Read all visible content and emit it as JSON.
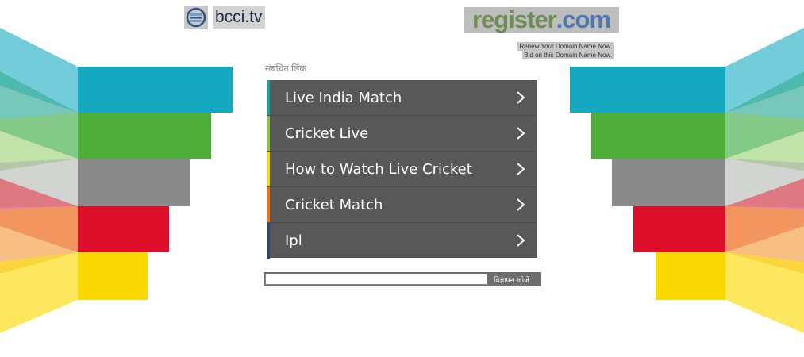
{
  "site": {
    "logo_text": "bcci.tv",
    "logo_icon": "e-logo-icon"
  },
  "registrar": {
    "logo_main": "register",
    "logo_tld": ".com",
    "links": [
      "Renew Your Domain Name Now.",
      "Bid on this Domain Name Now."
    ]
  },
  "related": {
    "title": "संबंधित लिंक",
    "items": [
      {
        "label": "Live India Match",
        "accent": "#1f9fa2"
      },
      {
        "label": "Cricket Live",
        "accent": "#8cc63f"
      },
      {
        "label": "How to Watch Live Cricket",
        "accent": "#f5d60a"
      },
      {
        "label": "Cricket Match",
        "accent": "#e8731c"
      },
      {
        "label": "Ipl",
        "accent": "#2a4a6e"
      }
    ],
    "chevron_icon": "chevron-right-icon"
  },
  "search": {
    "value": "",
    "button_label": "विज्ञापन खोजें"
  },
  "colors": {
    "page_bg": "#ffffff",
    "panel_bg": "#585858",
    "stripes": [
      "#14a9c1",
      "#4fad3a",
      "#8a8a8a",
      "#dd0f2a",
      "#fbd800"
    ]
  }
}
